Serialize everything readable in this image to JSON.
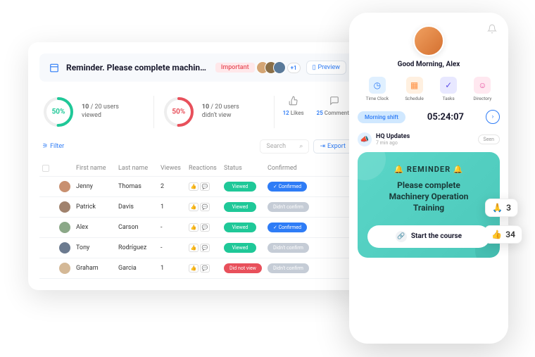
{
  "desktop": {
    "title": "Reminder. Please complete machinery....",
    "tag": "Important",
    "avatar_plus": "+1",
    "preview": "Preview",
    "stat_viewed": {
      "pct": "50%",
      "num": "10",
      "total": "/ 20 users",
      "label": "viewed"
    },
    "stat_didnt": {
      "pct": "50%",
      "num": "10",
      "total": "/ 20 users",
      "label": "didn't view"
    },
    "likes": {
      "count": "12",
      "label": "Likes"
    },
    "comments": {
      "count": "25",
      "label": "Comments"
    },
    "filter": "Filter",
    "search_ph": "Search",
    "export": "Export",
    "columns": {
      "first": "First name",
      "last": "Last name",
      "views": "Viewes",
      "react": "Reactions",
      "status": "Status",
      "conf": "Confirmed"
    },
    "rows": [
      {
        "fn": "Jenny",
        "ln": "Thomas",
        "vw": "2",
        "st": "Viewed",
        "stc": "p-green",
        "cf": "✓ Confirmed",
        "cfc": "p-blue"
      },
      {
        "fn": "Patrick",
        "ln": "Davis",
        "vw": "1",
        "st": "Viewed",
        "stc": "p-green",
        "cf": "Didn't confirm",
        "cfc": "p-grey"
      },
      {
        "fn": "Alex",
        "ln": "Carson",
        "vw": "-",
        "st": "Viewed",
        "stc": "p-green",
        "cf": "✓ Confirmed",
        "cfc": "p-blue"
      },
      {
        "fn": "Tony",
        "ln": "Rodríguez",
        "vw": "-",
        "st": "Viewed",
        "stc": "p-green",
        "cf": "Didn't confirm",
        "cfc": "p-grey"
      },
      {
        "fn": "Graham",
        "ln": "Garcia",
        "vw": "1",
        "st": "Did not view",
        "stc": "p-red",
        "cf": "Didn't confirm",
        "cfc": "p-grey"
      }
    ]
  },
  "mobile": {
    "greeting": "Good Morning, Alex",
    "apps": [
      {
        "label": "Time Clock",
        "cls": "ai1",
        "ico": "◷"
      },
      {
        "label": "Schedule",
        "cls": "ai2",
        "ico": "▦"
      },
      {
        "label": "Tasks",
        "cls": "ai3",
        "ico": "✓"
      },
      {
        "label": "Directory",
        "cls": "ai4",
        "ico": "☺"
      }
    ],
    "shift_label": "Morning shift",
    "timer": "05:24:07",
    "feed": {
      "title": "HQ Updates",
      "time": "7 min ago",
      "seen": "Seen"
    },
    "card": {
      "title": "🔔 REMINDER 🔔",
      "body1": "Please complete",
      "body2": "Machinery Operation",
      "body3": "Training",
      "cta": "Start the course"
    }
  },
  "floats": {
    "pray": "🙏",
    "pray_n": "3",
    "thumb": "👍",
    "thumb_n": "34"
  }
}
